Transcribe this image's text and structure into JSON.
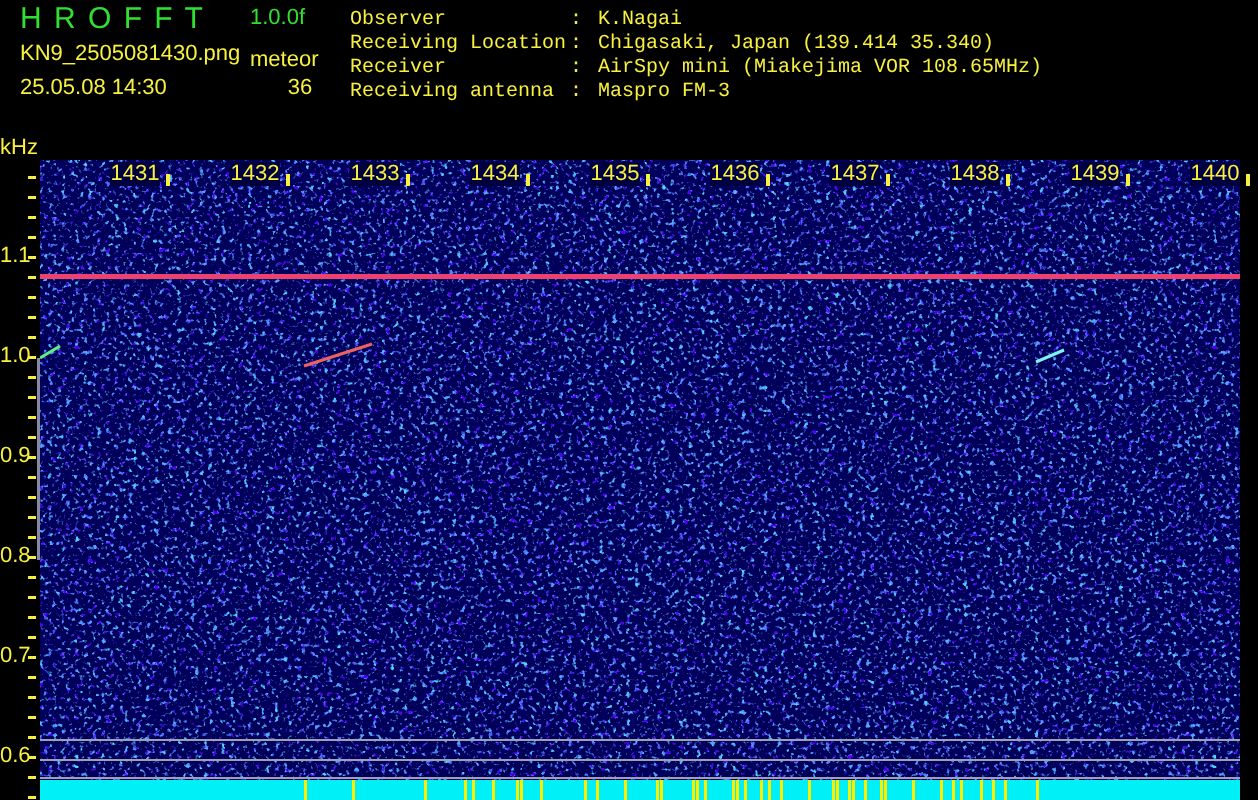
{
  "app": {
    "title": "H R O F F T",
    "version": "1.0.0f"
  },
  "file": {
    "name": "KN9_2505081430.png",
    "timestamp": "25.05.08 14:30"
  },
  "counter": {
    "label": "meteor",
    "value": "36"
  },
  "info": [
    {
      "label": "Observer",
      "separator": ":",
      "value": "K.Nagai"
    },
    {
      "label": "Receiving Location",
      "separator": ":",
      "value": "Chigasaki, Japan (139.414 35.340)"
    },
    {
      "label": "Receiver",
      "separator": ":",
      "value": "AirSpy mini (Miakejima VOR 108.65MHz)"
    },
    {
      "label": "Receiving antenna",
      "separator": ":",
      "value": "Maspro FM-3"
    }
  ],
  "spectrogram": {
    "y_unit": "kHz",
    "y_labels": [
      "1.1",
      "1.0",
      "0.9",
      "0.8",
      "0.7",
      "0.6"
    ],
    "x_labels": [
      "1431",
      "1432",
      "1433",
      "1434",
      "1435",
      "1436",
      "1437",
      "1438",
      "1439",
      "1440"
    ]
  }
}
